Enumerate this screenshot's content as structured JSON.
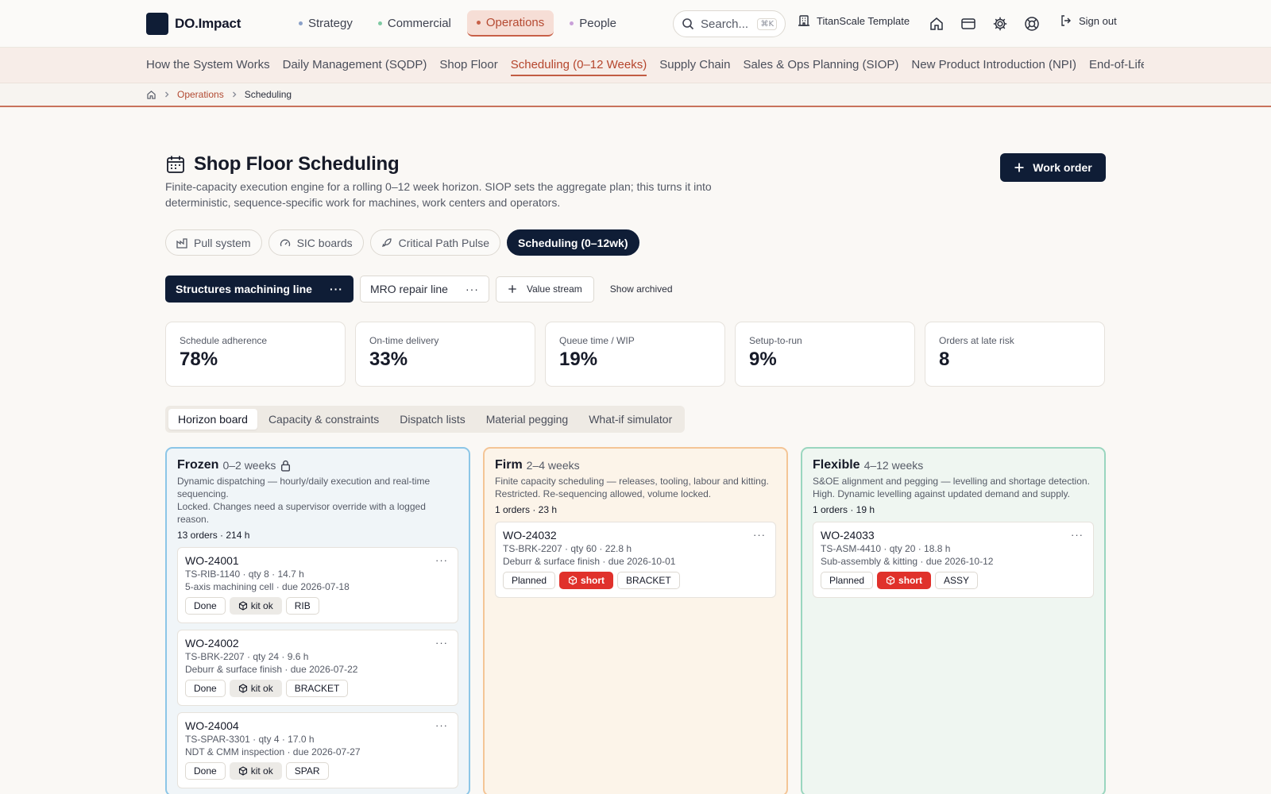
{
  "brand": {
    "name": "DO.Impact"
  },
  "modules": [
    {
      "label": "Strategy",
      "dot": "#8aa0c8"
    },
    {
      "label": "Commercial",
      "dot": "#7fc9a3"
    },
    {
      "label": "Operations",
      "dot": "#c86048"
    },
    {
      "label": "People",
      "dot": "#c9a0d9"
    }
  ],
  "search": {
    "placeholder": "Search...",
    "shortcut": "⌘K"
  },
  "tenant": {
    "label": "TitanScale Template"
  },
  "header_actions": {
    "signout_label": "Sign out"
  },
  "sections": [
    "How the System Works",
    "Daily Management (SQDP)",
    "Shop Floor",
    "Scheduling (0–12 Weeks)",
    "Supply Chain",
    "Sales & Ops Planning (SIOP)",
    "New Product Introduction (NPI)",
    "End-of-Life",
    "C"
  ],
  "breadcrumb": {
    "parent": "Operations",
    "current": "Scheduling"
  },
  "page": {
    "title": "Shop Floor Scheduling",
    "description": "Finite-capacity execution engine for a rolling 0–12 week horizon. SIOP sets the aggregate plan; this turns it into deterministic, sequence-specific work for machines, work centers and operators.",
    "primary_action": "Work order"
  },
  "modes": [
    {
      "label": "Pull system",
      "icon": "factory-icon"
    },
    {
      "label": "SIC boards",
      "icon": "gauge-icon"
    },
    {
      "label": "Critical Path Pulse",
      "icon": "rocket-icon"
    },
    {
      "label": "Scheduling (0–12wk)",
      "icon": ""
    }
  ],
  "value_streams": {
    "items": [
      "Structures machining line",
      "MRO repair line"
    ],
    "add_label": "Value stream",
    "archived_label": "Show archived"
  },
  "kpis": [
    {
      "label": "Schedule adherence",
      "value": "78%"
    },
    {
      "label": "On-time delivery",
      "value": "33%"
    },
    {
      "label": "Queue time / WIP",
      "value": "19%"
    },
    {
      "label": "Setup-to-run",
      "value": "9%"
    },
    {
      "label": "Orders at late risk",
      "value": "8"
    }
  ],
  "subtabs": [
    "Horizon board",
    "Capacity & constraints",
    "Dispatch lists",
    "Material pegging",
    "What-if simulator"
  ],
  "columns": {
    "frozen": {
      "title": "Frozen",
      "range": "0–2 weeks",
      "desc1": "Dynamic dispatching — hourly/daily execution and real-time sequencing.",
      "desc2": "Locked. Changes need a supervisor override with a logged reason.",
      "stats": "13 orders · 214 h",
      "cards": [
        {
          "id": "WO-24001",
          "line1": "TS-RIB-1140 · qty 8 · 14.7 h",
          "line2": "5-axis machining cell · due 2026-07-18",
          "status": "Done",
          "kit": "kit ok",
          "family": "RIB"
        },
        {
          "id": "WO-24002",
          "line1": "TS-BRK-2207 · qty 24 · 9.6 h",
          "line2": "Deburr & surface finish · due 2026-07-22",
          "status": "Done",
          "kit": "kit ok",
          "family": "BRACKET"
        },
        {
          "id": "WO-24004",
          "line1": "TS-SPAR-3301 · qty 4 · 17.0 h",
          "line2": "NDT & CMM inspection · due 2026-07-27",
          "status": "Done",
          "kit": "kit ok",
          "family": "SPAR"
        }
      ]
    },
    "firm": {
      "title": "Firm",
      "range": "2–4 weeks",
      "desc1": "Finite capacity scheduling — releases, tooling, labour and kitting.",
      "desc2": "Restricted. Re-sequencing allowed, volume locked.",
      "stats": "1 orders · 23 h",
      "cards": [
        {
          "id": "WO-24032",
          "line1": "TS-BRK-2207 · qty 60 · 22.8 h",
          "line2": "Deburr & surface finish · due 2026-10-01",
          "status": "Planned",
          "kit": "short",
          "family": "BRACKET"
        }
      ]
    },
    "flexible": {
      "title": "Flexible",
      "range": "4–12 weeks",
      "desc1": "S&OE alignment and pegging — levelling and shortage detection.",
      "desc2": "High. Dynamic levelling against updated demand and supply.",
      "stats": "1 orders · 19 h",
      "cards": [
        {
          "id": "WO-24033",
          "line1": "TS-ASM-4410 · qty 20 · 18.8 h",
          "line2": "Sub-assembly & kitting · due 2026-10-12",
          "status": "Planned",
          "kit": "short",
          "family": "ASSY"
        }
      ]
    }
  }
}
